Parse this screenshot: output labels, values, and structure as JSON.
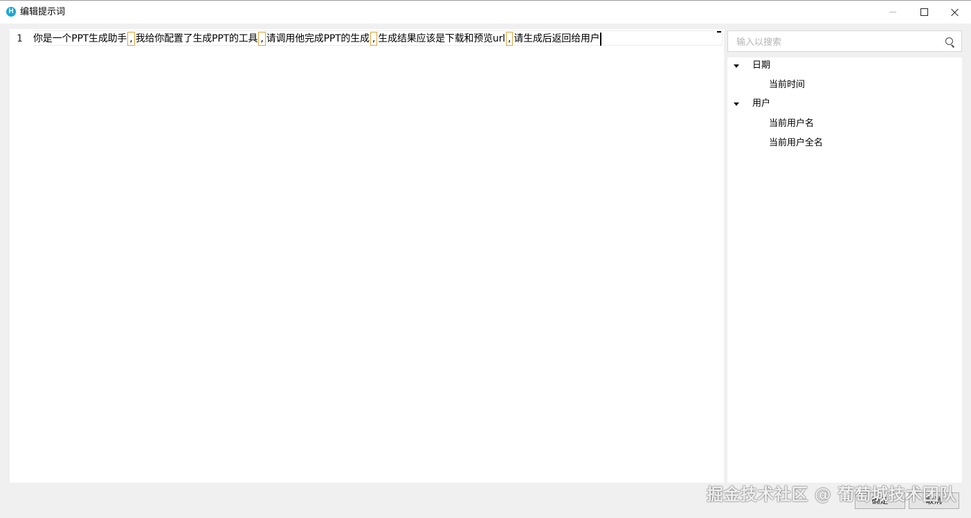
{
  "window": {
    "title": "编辑提示词",
    "icon": "H"
  },
  "editor": {
    "line_number": "1",
    "segments": [
      {
        "text": "你是一个PPT生成助手",
        "type": "text"
      },
      {
        "text": ",",
        "type": "comma"
      },
      {
        "text": "我给你配置了生成PPT的工具",
        "type": "text"
      },
      {
        "text": ",",
        "type": "comma"
      },
      {
        "text": "请调用他完成PPT的生成",
        "type": "text"
      },
      {
        "text": ",",
        "type": "comma"
      },
      {
        "text": "生成结果应该是下载和预览url",
        "type": "text"
      },
      {
        "text": ",",
        "type": "comma"
      },
      {
        "text": "请生成后返回给用户",
        "type": "text"
      }
    ]
  },
  "sidepanel": {
    "search_placeholder": "输入以搜索",
    "tree": [
      {
        "label": "日期",
        "children": [
          "当前时间"
        ]
      },
      {
        "label": "用户",
        "children": [
          "当前用户名",
          "当前用户全名"
        ]
      }
    ]
  },
  "buttons": {
    "ok": "确定",
    "cancel": "取消"
  },
  "watermark": "掘金技术社区 @ 葡萄城技术团队",
  "colors": {
    "comma_highlight": "#e0a339",
    "app_icon": "#1aa7d6"
  }
}
